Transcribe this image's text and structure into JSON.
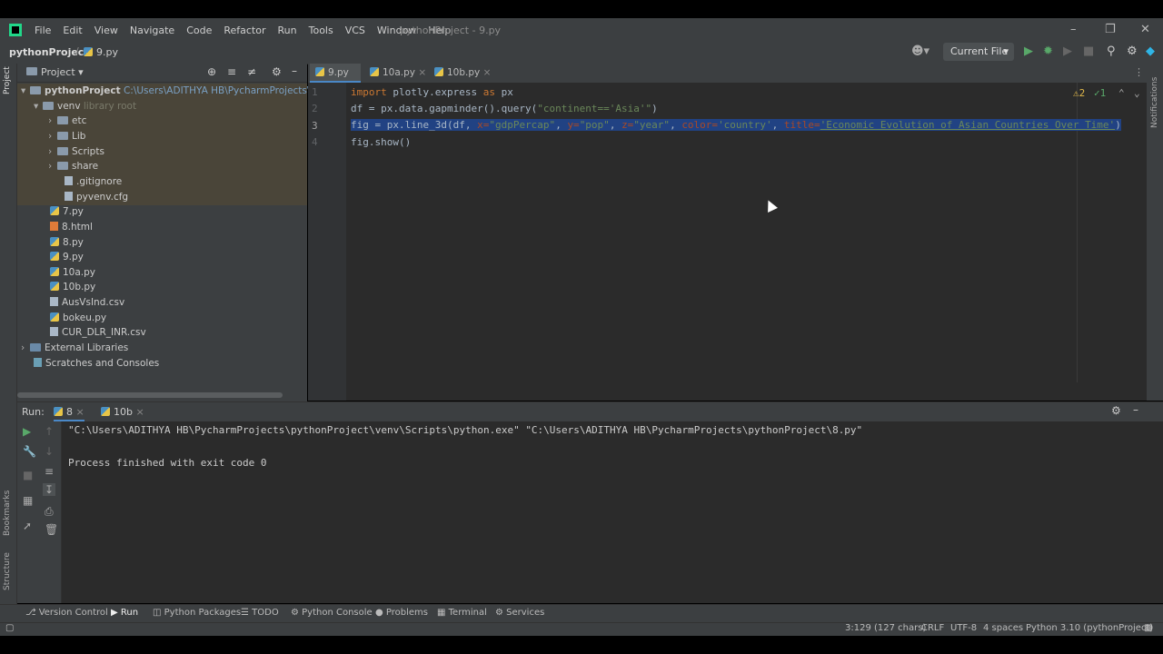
{
  "menu": {
    "items": [
      "File",
      "Edit",
      "View",
      "Navigate",
      "Code",
      "Refactor",
      "Run",
      "Tools",
      "VCS",
      "Window",
      "Help"
    ],
    "window_title": "pythonProject - 9.py"
  },
  "nav": {
    "project": "pythonProject",
    "file": "9.py",
    "run_config": "Current File"
  },
  "project_panel": {
    "title": "Project",
    "root_name": "pythonProject",
    "root_path": "C:\\Users\\ADITHYA HB\\PycharmProjects\\pythonP",
    "venv": "venv",
    "venv_note": "library root",
    "items": [
      "etc",
      "Lib",
      "Scripts",
      "share",
      ".gitignore",
      "pyvenv.cfg",
      "7.py",
      "8.html",
      "8.py",
      "9.py",
      "10a.py",
      "10b.py",
      "AusVsInd.csv",
      "bokeu.py",
      "CUR_DLR_INR.csv",
      "External Libraries",
      "Scratches and Consoles"
    ]
  },
  "editor": {
    "tabs": [
      "9.py",
      "10a.py",
      "10b.py"
    ],
    "line_numbers": [
      "1",
      "2",
      "3",
      "4"
    ],
    "inspection": {
      "warnings": "2",
      "ok": "1"
    },
    "line1": {
      "kw": "import",
      "mid": " plotly.express ",
      "kw2": "as",
      "end": " px"
    },
    "line2": {
      "pre": "df = px.data.gapminder().query(",
      "str": "\"continent=='Asia'\"",
      "post": ")"
    },
    "line3": {
      "pre": "fig = px.line_3d(df, ",
      "x_kw": "x=",
      "x_val": "\"gdpPercap\"",
      "sep1": ", ",
      "y_kw": "y=",
      "y_val": "\"pop\"",
      "sep2": ", ",
      "z_kw": "z=",
      "z_val": "\"year\"",
      "sep3": ", ",
      "color_kw": "color=",
      "color_val": "'country'",
      "sep4": ", ",
      "title_kw": "title=",
      "title_val": "'Economic Evolution of Asian Countries Over Time'",
      "post": ")"
    },
    "line4": "fig.show()"
  },
  "run_panel": {
    "label": "Run:",
    "tabs": [
      "8",
      "10b"
    ],
    "console": [
      "\"C:\\Users\\ADITHYA HB\\PycharmProjects\\pythonProject\\venv\\Scripts\\python.exe\" \"C:\\Users\\ADITHYA HB\\PycharmProjects\\pythonProject\\8.py\"",
      "Process finished with exit code 0"
    ]
  },
  "tool_windows": [
    "Version Control",
    "Run",
    "Python Packages",
    "TODO",
    "Python Console",
    "Problems",
    "Terminal",
    "Services"
  ],
  "side_labels": {
    "project": "Project",
    "bookmarks": "Bookmarks",
    "structure": "Structure",
    "notifications": "Notifications"
  },
  "status": {
    "position": "3:129 (127 chars)",
    "line_sep": "CRLF",
    "encoding": "UTF-8",
    "indent": "4 spaces",
    "interpreter": "Python 3.10 (pythonProject)"
  }
}
